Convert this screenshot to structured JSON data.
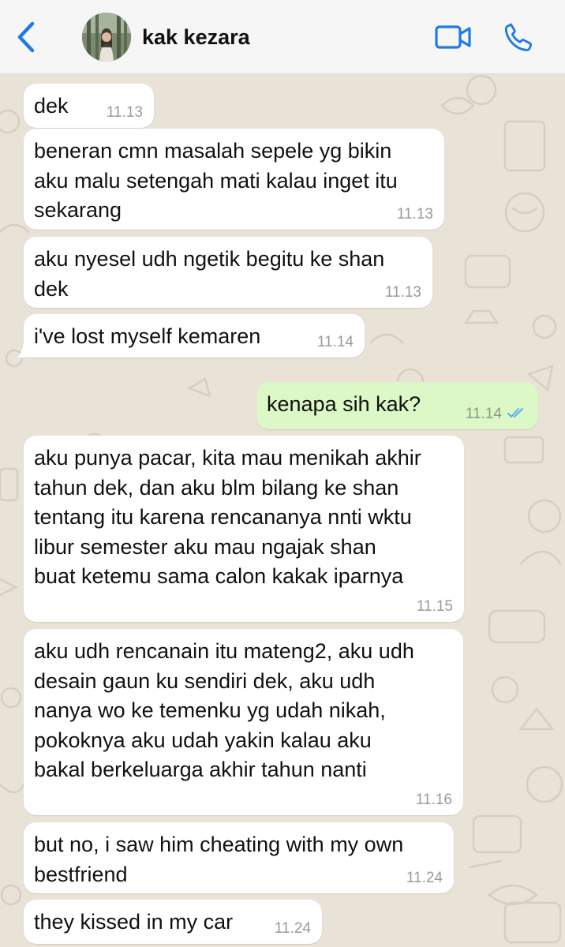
{
  "header": {
    "contact_name": "kak kezara"
  },
  "icons": {
    "back": "chevron-left-icon",
    "video": "video-camera-icon",
    "call": "phone-icon"
  },
  "colors": {
    "accent": "#1e7ae6",
    "incoming_bubble": "#ffffff",
    "outgoing_bubble": "#dcf8c6",
    "read_ticks": "#4fb3e8",
    "wallpaper": "#e9e2d6"
  },
  "messages": [
    {
      "direction": "incoming",
      "text": "dek",
      "time": "11.13"
    },
    {
      "direction": "incoming",
      "text": "beneran cmn masalah sepele yg bikin\naku malu setengah mati kalau inget itu\nsekarang",
      "time": "11.13"
    },
    {
      "direction": "incoming",
      "text": "aku nyesel udh ngetik begitu ke shan\ndek",
      "time": "11.13"
    },
    {
      "direction": "incoming",
      "text": "i've lost myself kemaren",
      "time": "11.14"
    },
    {
      "direction": "outgoing",
      "text": "kenapa sih kak?",
      "time": "11.14",
      "status": "read"
    },
    {
      "direction": "incoming",
      "text": "aku punya pacar, kita mau menikah akhir\ntahun dek, dan aku blm bilang ke shan\ntentang itu karena rencananya nnti wktu\nlibur semester aku mau ngajak shan\nbuat ketemu sama calon kakak iparnya",
      "time": "11.15"
    },
    {
      "direction": "incoming",
      "text": "aku udh rencanain itu mateng2, aku udh\ndesain gaun ku sendiri dek, aku udh\nnanya wo ke temenku yg udah nikah,\npokoknya aku udah yakin kalau aku\nbakal berkeluarga akhir tahun nanti",
      "time": "11.16"
    },
    {
      "direction": "incoming",
      "text": "but no, i saw him cheating with my own\nbestfriend",
      "time": "11.24"
    },
    {
      "direction": "incoming",
      "text": "they kissed in my car",
      "time": "11.24"
    }
  ]
}
